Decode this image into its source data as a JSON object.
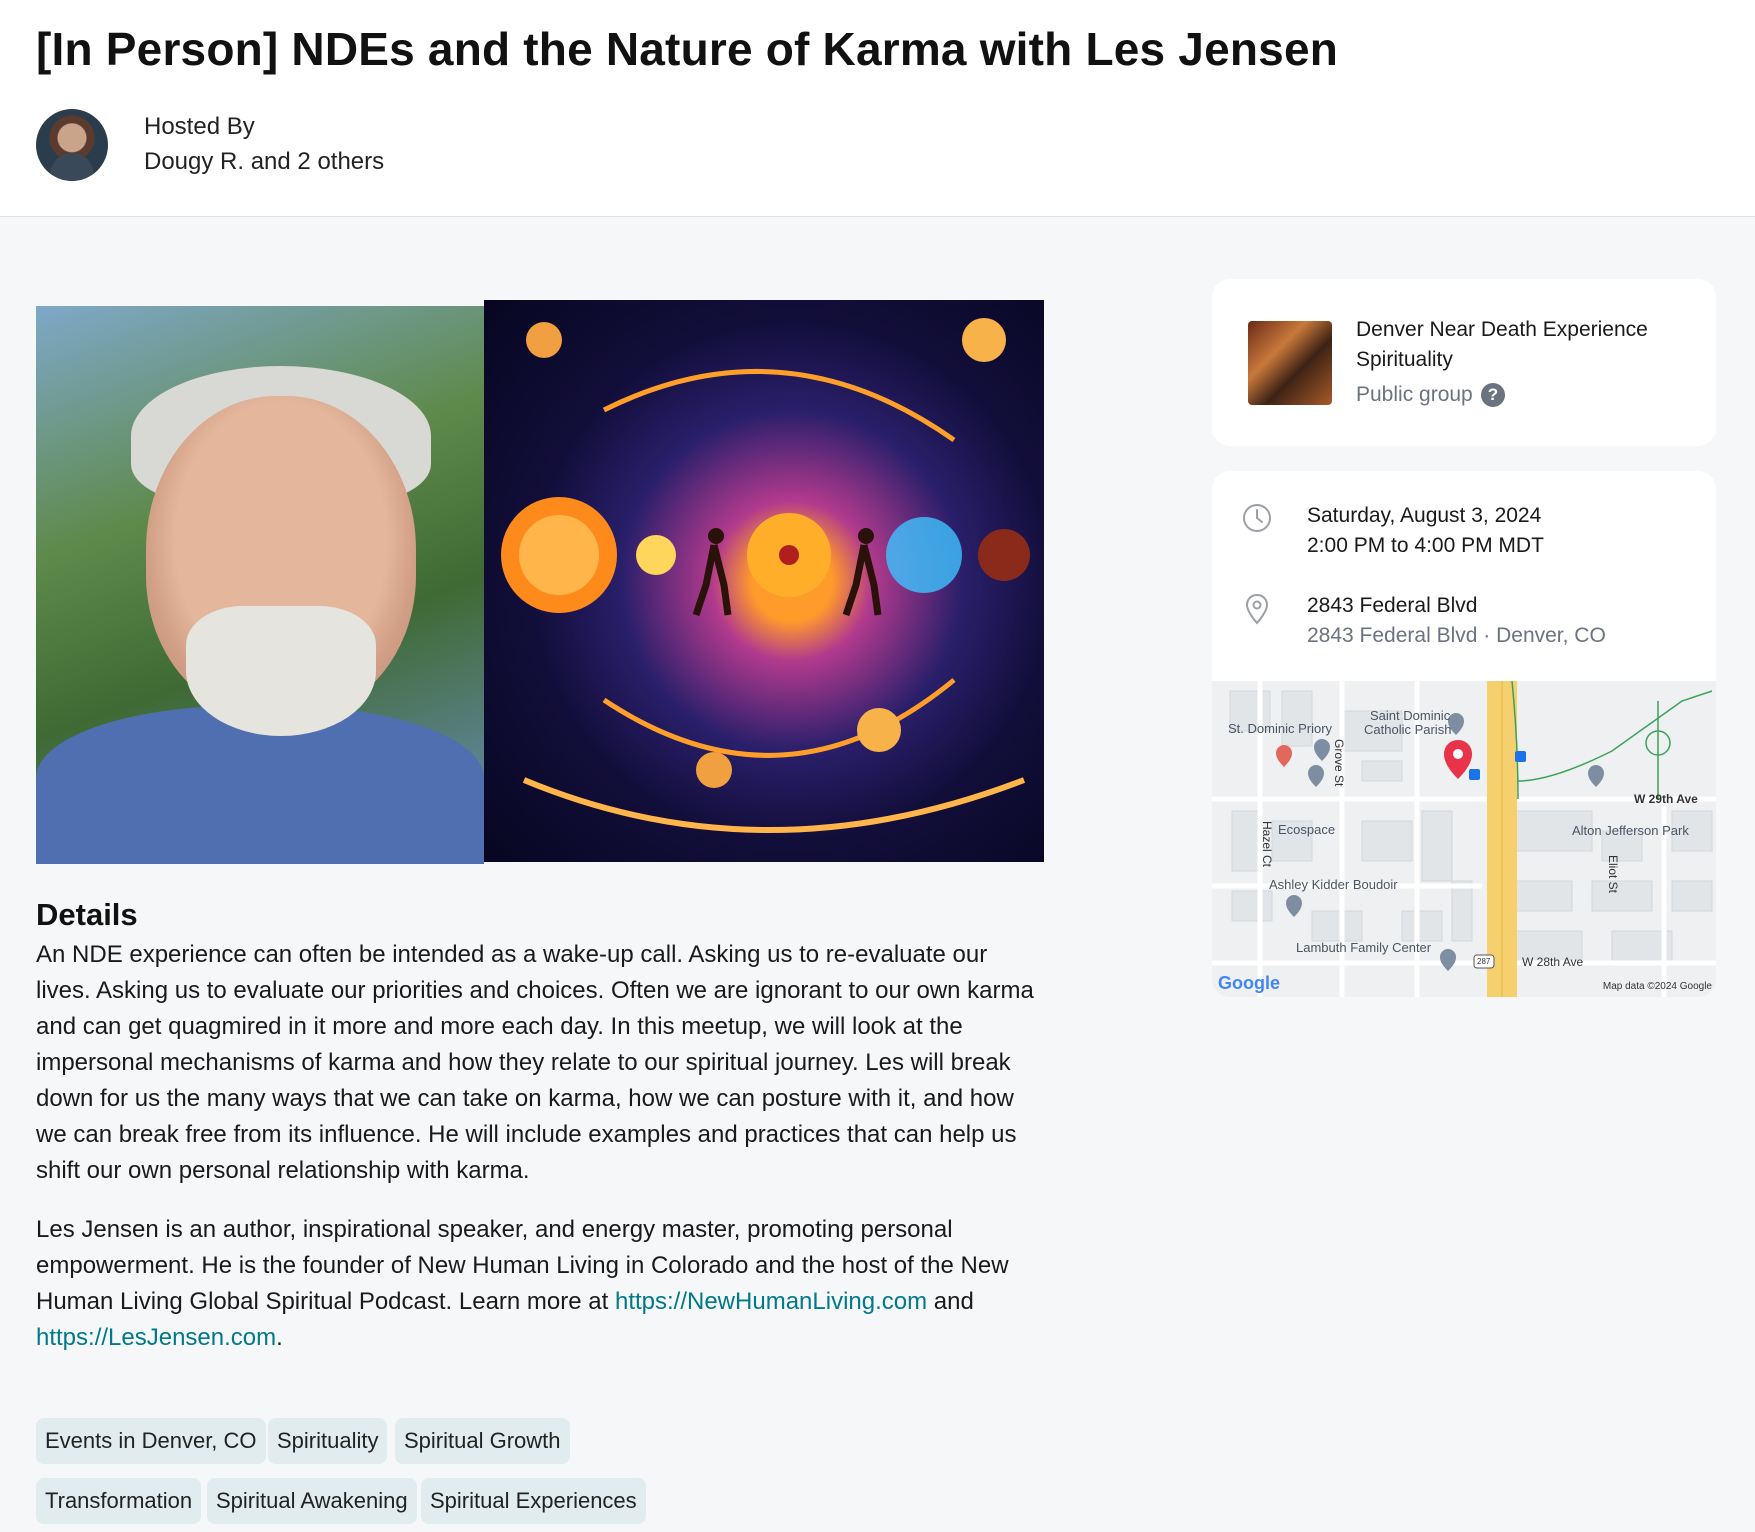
{
  "event": {
    "title": "[In Person] NDEs and the Nature of Karma with Les Jensen",
    "hosted_by_label": "Hosted By",
    "hosts": "Dougy R. and 2 others"
  },
  "details": {
    "heading": "Details",
    "paragraph1": "An NDE experience can often be intended as a wake-up call. Asking us to re-evaluate our lives. Asking us to evaluate our priorities and choices. Often we are ignorant to our own karma and can get quagmired in it more and more each day. In this meetup, we will look at the impersonal mechanisms of karma and how they relate to our spiritual journey. Les will break down for us the many ways that we can take on karma, how we can posture with it, and how we can break free from its influence. He will include examples and practices that can help us shift our own personal relationship with karma.",
    "paragraph2_text": "Les Jensen is an author, inspirational speaker, and energy master, promoting personal empowerment. He is the founder of New Human Living in Colorado and the host of the New Human Living Global Spiritual Podcast. Learn more at",
    "link1": "https://NewHumanLiving.com",
    "and_text": "and",
    "link2": "https://LesJensen.com",
    "end_period": "."
  },
  "tags": [
    "Events in Denver, CO",
    "Spirituality",
    "Spiritual Growth",
    "Transformation",
    "Spiritual Awakening",
    "Spiritual Experiences"
  ],
  "group": {
    "name": "Denver Near Death Experience Spirituality",
    "type": "Public group",
    "help_icon": "?"
  },
  "when": {
    "date": "Saturday, August 3, 2024",
    "time": "2:00 PM to 4:00 PM MDT"
  },
  "where": {
    "venue": "2843 Federal Blvd",
    "address": "2843 Federal Blvd · Denver, CO"
  },
  "map": {
    "places": [
      "St. Dominic Priory",
      "Saint Dominic",
      "Catholic Parish",
      "Ecospace",
      "Ashley Kidder Boudoir",
      "Lambuth Family Center",
      "Alton Jefferson Park"
    ],
    "streets": [
      "Grove St",
      "Hazel Ct",
      "W 29th Ave",
      "W 28th Ave",
      "Eliot St"
    ],
    "route_shield": "287",
    "logo": "Google",
    "credit": "Map data ©2024 Google"
  },
  "colors": {
    "link": "#00798a",
    "tag_bg": "#e0ecee",
    "map_pin": "#e8334a",
    "road_highlight": "#f6cf6e"
  }
}
